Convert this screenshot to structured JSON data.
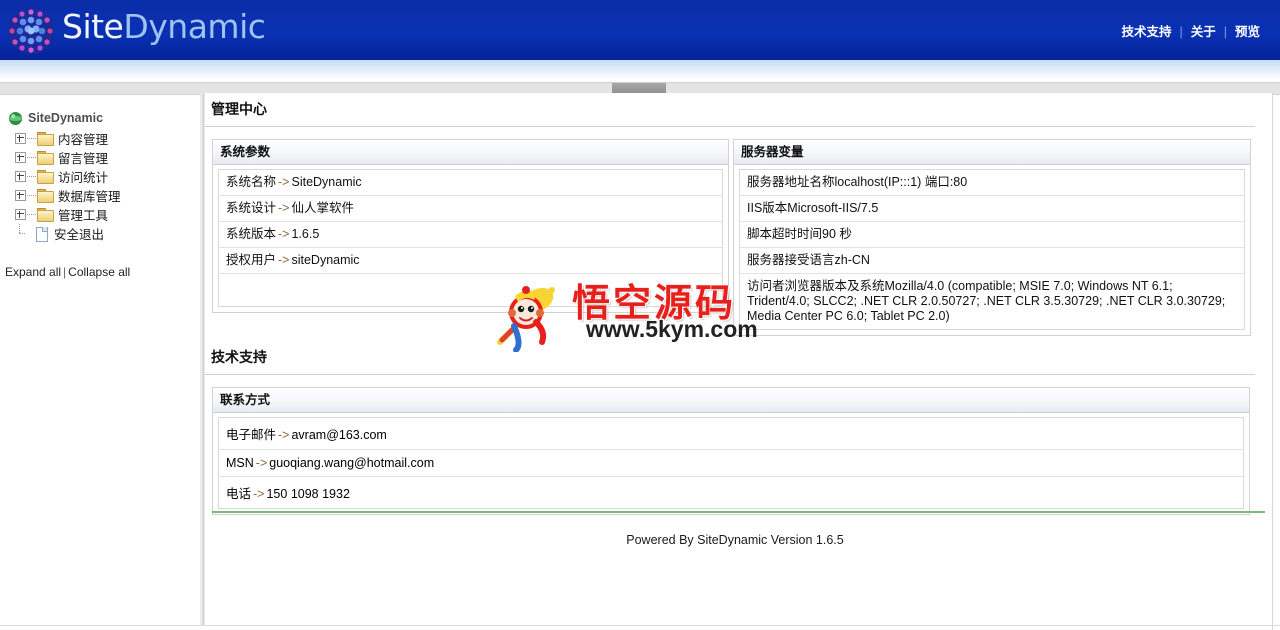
{
  "header": {
    "logo_text_part1": "Site",
    "logo_text_part2": "Dynamic",
    "logo_icon": "sphere-dots-logo",
    "nav": [
      {
        "label": "技术支持"
      },
      {
        "label": "关于"
      },
      {
        "label": "预览"
      }
    ],
    "nav_separator": "|"
  },
  "sidebar": {
    "root_label": "SiteDynamic",
    "root_icon": "globe-icon",
    "items": [
      {
        "label": "内容管理",
        "icon": "folder-icon",
        "expander": "plus"
      },
      {
        "label": "留言管理",
        "icon": "folder-icon",
        "expander": "plus"
      },
      {
        "label": "访问统计",
        "icon": "folder-icon",
        "expander": "plus"
      },
      {
        "label": "数据库管理",
        "icon": "folder-icon",
        "expander": "plus"
      },
      {
        "label": "管理工具",
        "icon": "folder-icon",
        "expander": "plus"
      },
      {
        "label": "安全退出",
        "icon": "page-icon",
        "expander": "none"
      }
    ],
    "expand_all": "Expand all",
    "collapse_all": "Collapse all",
    "links_separator": "|"
  },
  "main": {
    "page_title": "管理中心",
    "system_params": {
      "heading": "系统参数",
      "rows": [
        {
          "key": "系统名称",
          "arrow": "->",
          "value": "SiteDynamic"
        },
        {
          "key": "系统设计",
          "arrow": "->",
          "value": "仙人掌软件"
        },
        {
          "key": "系统版本",
          "arrow": "->",
          "value": "1.6.5"
        },
        {
          "key": "授权用户",
          "arrow": "->",
          "value": "siteDynamic"
        },
        {
          "key": "",
          "arrow": "",
          "value": ""
        }
      ]
    },
    "server_vars": {
      "heading": "服务器变量",
      "rows": [
        {
          "text": "服务器地址名称localhost(IP:::1) 端口:80"
        },
        {
          "text": "IIS版本Microsoft-IIS/7.5"
        },
        {
          "text": "脚本超时时间90 秒"
        },
        {
          "text": "服务器接受语言zh-CN"
        },
        {
          "text": "访问者浏览器版本及系统Mozilla/4.0 (compatible; MSIE 7.0; Windows NT 6.1; Trident/4.0; SLCC2; .NET CLR 2.0.50727; .NET CLR 3.5.30729; .NET CLR 3.0.30729; Media Center PC 6.0; Tablet PC 2.0)"
        }
      ]
    },
    "tech_support": {
      "section_title": "技术支持",
      "panel_heading": "联系方式",
      "rows": [
        {
          "key": "电子邮件",
          "arrow": "->",
          "value": "avram@163.com"
        },
        {
          "key": "MSN",
          "arrow": "->",
          "value": "guoqiang.wang@hotmail.com"
        },
        {
          "key": "电话",
          "arrow": "->",
          "value": "150 1098 1932"
        }
      ]
    },
    "footer_text": "Powered By SiteDynamic Version 1.6.5"
  },
  "watermark": {
    "chinese": "悟空源码",
    "url": "www.5kym.com",
    "mascot": "monkey-king-mascot"
  },
  "colors": {
    "header_blue": "#0a2fae",
    "accent_green": "#7bb87b",
    "watermark_red": "#e8201c",
    "folder_yellow": "#eccf7a"
  }
}
